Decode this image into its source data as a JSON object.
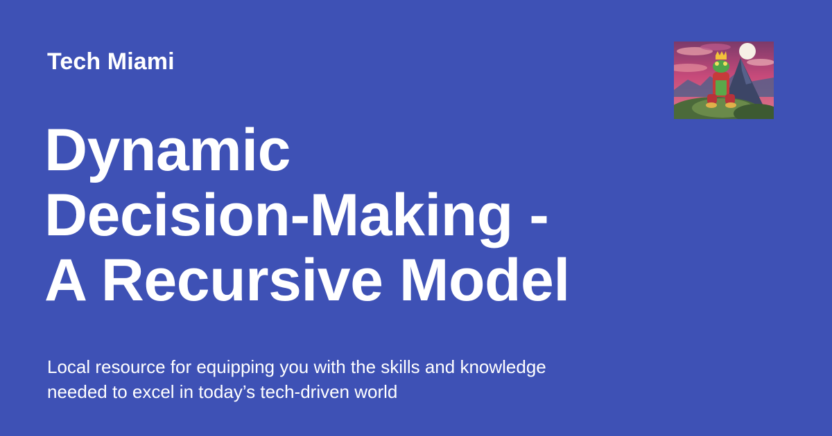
{
  "card": {
    "site_name": "Tech Miami",
    "headline_lines": [
      "Dynamic",
      "Decision-Making -",
      "A Recursive Model"
    ],
    "description_lines": [
      "Local resource for equipping you with the skills and knowledge",
      "needed to excel in today’s tech-driven world"
    ]
  },
  "colors": {
    "background": "#3e51b5",
    "text": "#ffffff"
  },
  "icons": {
    "thumbnail": "frog-king-on-mountain-illustration"
  }
}
